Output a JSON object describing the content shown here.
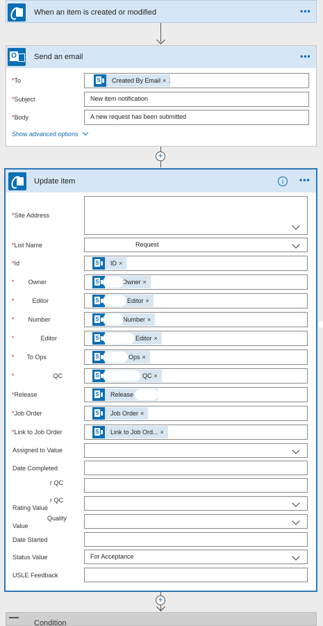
{
  "trigger": {
    "title": "When an item is created or modified",
    "icon": "sharepoint-icon",
    "menu_glyph": "•••"
  },
  "email": {
    "title": "Send an email",
    "icon": "outlook-icon",
    "menu_glyph": "•••",
    "to_label": "To",
    "to_token": "Created By Email",
    "to_suffix": ";",
    "subject_label": "Subject",
    "subject_value": "New item notification",
    "body_label": "Body",
    "body_value": "A new request has been submitted",
    "advanced_link": "Show advanced options",
    "required_mark": "*"
  },
  "update": {
    "title": "Update item",
    "icon": "sharepoint-icon",
    "info_glyph": "i",
    "menu_glyph": "•••",
    "required_mark": "*",
    "token_close": "×",
    "site_address_label": "Site Address",
    "list_name_label": "List Name",
    "list_name_value": "Request",
    "id_label": "Id",
    "id_token": "ID",
    "owner_label": "Owner",
    "owner_token": "Owner",
    "editor_label": "Editor",
    "editor_token": "Editor",
    "number_label": "Number",
    "number_token": "Number",
    "editor2_label": "Editor",
    "editor2_token": "Editor",
    "ops_label": "To Ops",
    "ops_token": "Ops",
    "qc_label": "QC",
    "qc_token": "QC",
    "release_label": "Release",
    "release_token": "Release I",
    "job_order_label": "Job Order",
    "job_order_token": "Job Order",
    "link_job_label": "Link to Job Order",
    "link_job_token": "Link to Job Ord...",
    "assigned_label": "Assigned to Value",
    "date_completed_label": "Date Completed",
    "r_qc_label": "r QC",
    "r_qc_rating_label_a": "r QC",
    "rating_value_label": "Rating Value",
    "quality_label": "Quality",
    "value_label": "Value",
    "date_started_label": "Date Started",
    "status_label": "Status Value",
    "status_value": "For Acceptance",
    "usle_label": "USLE Feedback"
  },
  "next": {
    "title": "Condition"
  },
  "colors": {
    "accent": "#0a6fb5",
    "header_bg": "#d6e6f5",
    "required": "#c4262e"
  }
}
